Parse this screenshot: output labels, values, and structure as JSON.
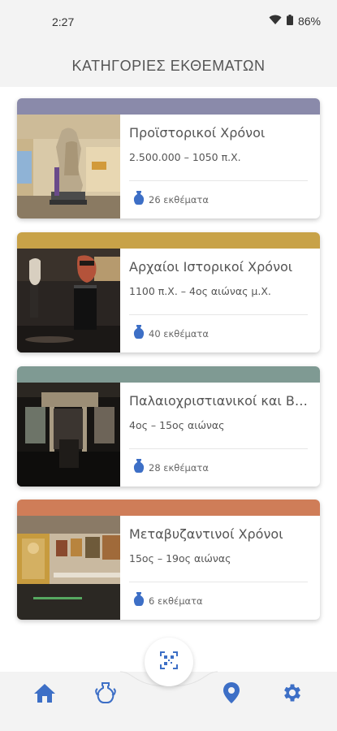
{
  "status": {
    "time": "2:27",
    "battery": "86%"
  },
  "header": {
    "title": "ΚΑΤΗΓΟΡΙΕΣ ΕΚΘΕΜΑΤΩΝ"
  },
  "colors": {
    "accent": "#3d6fc6",
    "band_1": "#8a8aaa",
    "band_2": "#c8a248",
    "band_3": "#7f9a93",
    "band_4": "#cf7d58"
  },
  "categories": [
    {
      "title": "Προϊστορικοί Χρόνοι",
      "period": "2.500.000 – 1050 π.Χ.",
      "count": "26 εκθέματα"
    },
    {
      "title": "Αρχαίοι Ιστορικοί Χρόνοι",
      "period": "1100 π.Χ. – 4ος αιώνας μ.Χ.",
      "count": "40 εκθέματα"
    },
    {
      "title": "Παλαιοχριστιανικοί και Βυζαντινοί Χρόνοι",
      "period": "4ος – 15ος αιώνας",
      "count": "28 εκθέματα"
    },
    {
      "title": "Μεταβυζαντινοί Χρόνοι",
      "period": "15ος – 19ος αιώνας",
      "count": "6 εκθέματα"
    }
  ],
  "nav": {
    "icons": [
      "home-icon",
      "amphora-icon",
      "qr-scan-icon",
      "location-pin-icon",
      "gear-icon"
    ]
  }
}
